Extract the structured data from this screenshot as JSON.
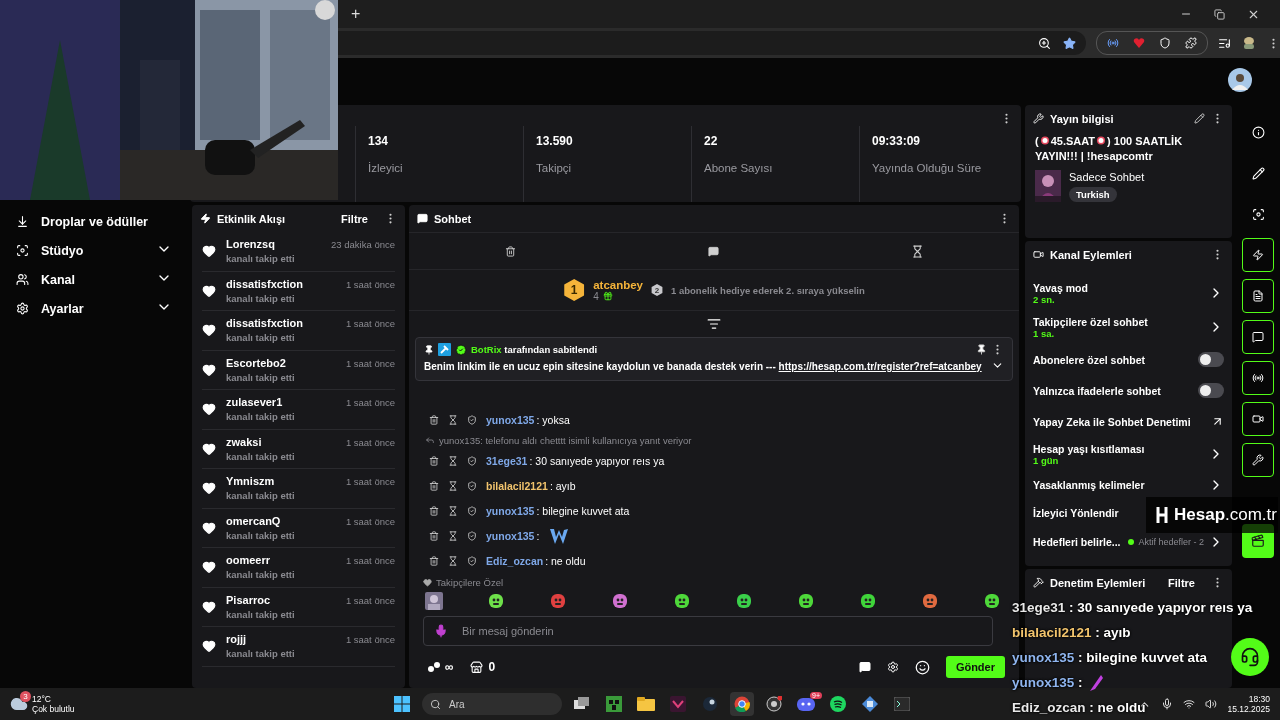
{
  "browser": {
    "new_tab": "+"
  },
  "stats": [
    {
      "value": "134",
      "label": "İzleyici"
    },
    {
      "value": "13.590",
      "label": "Takipçi"
    },
    {
      "value": "22",
      "label": "Abone Sayısı"
    },
    {
      "value": "09:33:09",
      "label": "Yayında Olduğu Süre"
    }
  ],
  "sidebar": {
    "items": [
      {
        "label": "Droplar ve ödüller",
        "kind": "link"
      },
      {
        "label": "Stüdyo",
        "kind": "group",
        "expanded": false
      },
      {
        "label": "Kanal",
        "kind": "group",
        "expanded": false
      },
      {
        "label": "Ayarlar",
        "kind": "group",
        "expanded": false
      }
    ]
  },
  "activity": {
    "title": "Etkinlik Akışı",
    "filter": "Filtre",
    "events": [
      {
        "user": "Lorenzsq",
        "action": "kanalı takip etti",
        "time": "23 dakika önce"
      },
      {
        "user": "dissatisfxction",
        "action": "kanalı takip etti",
        "time": "1 saat önce"
      },
      {
        "user": "dissatisfxction",
        "action": "kanalı takip etti",
        "time": "1 saat önce"
      },
      {
        "user": "Escortebo2",
        "action": "kanalı takip etti",
        "time": "1 saat önce"
      },
      {
        "user": "zulasever1",
        "action": "kanalı takip etti",
        "time": "1 saat önce"
      },
      {
        "user": "zwaksi",
        "action": "kanalı takip etti",
        "time": "1 saat önce"
      },
      {
        "user": "Ymniszm",
        "action": "kanalı takip etti",
        "time": "1 saat önce"
      },
      {
        "user": "omercanQ",
        "action": "kanalı takip etti",
        "time": "1 saat önce"
      },
      {
        "user": "oomeerr",
        "action": "kanalı takip etti",
        "time": "1 saat önce"
      },
      {
        "user": "Pisarroc",
        "action": "kanalı takip etti",
        "time": "1 saat önce"
      },
      {
        "user": "rojjj",
        "action": "kanalı takip etti",
        "time": "1 saat önce"
      }
    ]
  },
  "chat": {
    "title": "Sohbet",
    "leader": {
      "rank": "1",
      "user": "atcanbey",
      "points": "4",
      "next_rank": "2",
      "hint": "1 abonelik hediye ederek 2. sıraya yükselin"
    },
    "pinned": {
      "by": "BotRix",
      "suffix": "tarafından sabitlendi",
      "text": "Benim linkim ile en ucuz epin sitesine kaydolun ve banada destek verin --- ",
      "link": "https://hesap.com.tr/register?ref=atcanbey"
    },
    "messages": [
      {
        "kind": "text",
        "user": "yunox135",
        "color": "#7fa8e8",
        "text": ": yoksa"
      },
      {
        "kind": "reply",
        "text": "yunox135: telefonu aldı chetttt isimli kullanıcıya yanıt veriyor"
      },
      {
        "kind": "text",
        "user": "31ege31",
        "color": "#7fa8e8",
        "text": ": 30 sanıyede yapıyor reıs ya"
      },
      {
        "kind": "text",
        "user": "bilalacil2121",
        "color": "#f2c46d",
        "text": ": ayıb"
      },
      {
        "kind": "text",
        "user": "yunox135",
        "color": "#7fa8e8",
        "text": ": bilegine kuvvet ata"
      },
      {
        "kind": "emote",
        "user": "yunox135",
        "color": "#7fa8e8",
        "text": ":"
      },
      {
        "kind": "text",
        "user": "Ediz_ozcan",
        "color": "#7fa8e8",
        "text": ": ne oldu"
      }
    ],
    "emote_section": "Takipçilere Özel",
    "input": {
      "placeholder": "Bir mesaj gönderin"
    },
    "points": "∞",
    "store_count": "0",
    "send": "Gönder"
  },
  "stream_info": {
    "title": "Yayın bilgisi",
    "title_segments": [
      "(",
      "45.SAAT",
      ") 100 SAATLİK YAYIN!!! | !hesapcomtr"
    ],
    "category": "Sadece Sohbet",
    "tag": "Turkish"
  },
  "channel_actions": {
    "title": "Kanal Eylemleri",
    "items": [
      {
        "kind": "nav",
        "label": "Yavaş mod",
        "value": "2 sn."
      },
      {
        "kind": "nav",
        "label": "Takipçilere özel sohbet",
        "value": "1 sa."
      },
      {
        "kind": "toggle",
        "label": "Abonelere özel sohbet",
        "on": false
      },
      {
        "kind": "toggle",
        "label": "Yalnızca ifadelerle sohbet",
        "on": false
      },
      {
        "kind": "external",
        "label": "Yapay Zeka ile Sohbet Denetimi"
      },
      {
        "kind": "nav",
        "label": "Hesap yaşı kısıtlaması",
        "value": "1 gün"
      },
      {
        "kind": "nav",
        "label": "Yasaklanmış kelimeler"
      },
      {
        "kind": "plain",
        "label": "İzleyici Yönlendir"
      },
      {
        "kind": "goal",
        "label": "Hedefleri belirle...",
        "status": "Aktif hedefler - 2"
      }
    ]
  },
  "moderation": {
    "title": "Denetim Eylemleri",
    "filter": "Filtre"
  },
  "overlay_logo": "**Hesap**.com.tr",
  "overlay_chat": [
    {
      "kind": "text",
      "user": "31ege31",
      "color": "#e8e8e8",
      "text": ": 30 sanıyede yapıyor reıs ya"
    },
    {
      "kind": "text",
      "user": "bilalacil2121",
      "color": "#f2c46d",
      "text": ": ayıb"
    },
    {
      "kind": "text",
      "user": "yunox135",
      "color": "#8fb5ef",
      "text": ": bilegine kuvvet ata"
    },
    {
      "kind": "emote",
      "user": "yunox135",
      "color": "#8fb5ef",
      "text": ":"
    },
    {
      "kind": "text",
      "user": "Ediz_ozcan",
      "color": "#e8e8e8",
      "text": ": ne oldu"
    }
  ],
  "taskbar": {
    "weather_badge": "3",
    "temperature": "12°C",
    "weather": "Çok bulutlu",
    "search": "Ara",
    "app_badge": "9+",
    "time": "18:30",
    "date": "15.12.2025"
  }
}
